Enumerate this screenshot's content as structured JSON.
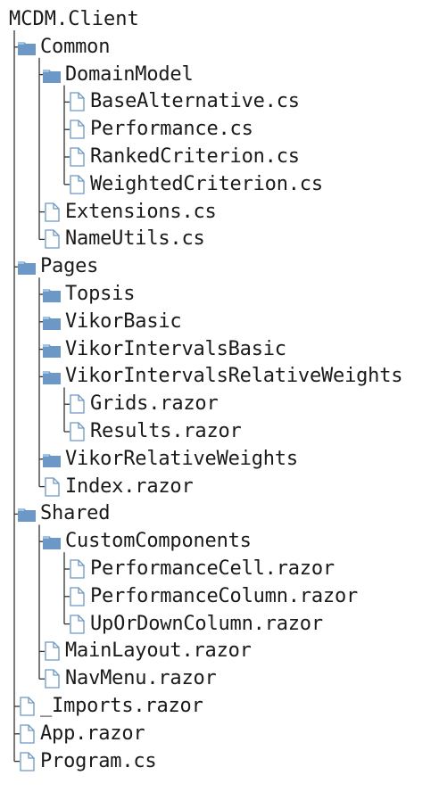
{
  "tree": {
    "root": "MCDM.Client",
    "items": [
      {
        "label": "Common",
        "type": "folder",
        "depth": 1
      },
      {
        "label": "DomainModel",
        "type": "folder",
        "depth": 2
      },
      {
        "label": "BaseAlternative.cs",
        "type": "file",
        "depth": 3
      },
      {
        "label": "Performance.cs",
        "type": "file",
        "depth": 3
      },
      {
        "label": "RankedCriterion.cs",
        "type": "file",
        "depth": 3
      },
      {
        "label": "WeightedCriterion.cs",
        "type": "file",
        "depth": 3
      },
      {
        "label": "Extensions.cs",
        "type": "file",
        "depth": 2
      },
      {
        "label": "NameUtils.cs",
        "type": "file",
        "depth": 2
      },
      {
        "label": "Pages",
        "type": "folder",
        "depth": 1
      },
      {
        "label": "Topsis",
        "type": "folder",
        "depth": 2
      },
      {
        "label": "VikorBasic",
        "type": "folder",
        "depth": 2
      },
      {
        "label": "VikorIntervalsBasic",
        "type": "folder",
        "depth": 2
      },
      {
        "label": "VikorIntervalsRelativeWeights",
        "type": "folder",
        "depth": 2
      },
      {
        "label": "Grids.razor",
        "type": "file",
        "depth": 3
      },
      {
        "label": "Results.razor",
        "type": "file",
        "depth": 3
      },
      {
        "label": "VikorRelativeWeights",
        "type": "folder",
        "depth": 2
      },
      {
        "label": "Index.razor",
        "type": "file",
        "depth": 2
      },
      {
        "label": "Shared",
        "type": "folder",
        "depth": 1
      },
      {
        "label": "CustomComponents",
        "type": "folder",
        "depth": 2
      },
      {
        "label": "PerformanceCell.razor",
        "type": "file",
        "depth": 3
      },
      {
        "label": "PerformanceColumn.razor",
        "type": "file",
        "depth": 3
      },
      {
        "label": "UpOrDownColumn.razor",
        "type": "file",
        "depth": 3
      },
      {
        "label": "MainLayout.razor",
        "type": "file",
        "depth": 2
      },
      {
        "label": "NavMenu.razor",
        "type": "file",
        "depth": 2
      },
      {
        "label": "_Imports.razor",
        "type": "file",
        "depth": 1
      },
      {
        "label": "App.razor",
        "type": "file",
        "depth": 1
      },
      {
        "label": "Program.cs",
        "type": "file",
        "depth": 1
      }
    ]
  },
  "icons": {
    "folder": "folder-icon",
    "file": "file-icon"
  },
  "colors": {
    "folder_fill": "#6b98c6",
    "folder_tab": "#9ec3e6",
    "file_stroke": "#6b98c6",
    "line": "#333333",
    "text": "#1a1a1a"
  }
}
